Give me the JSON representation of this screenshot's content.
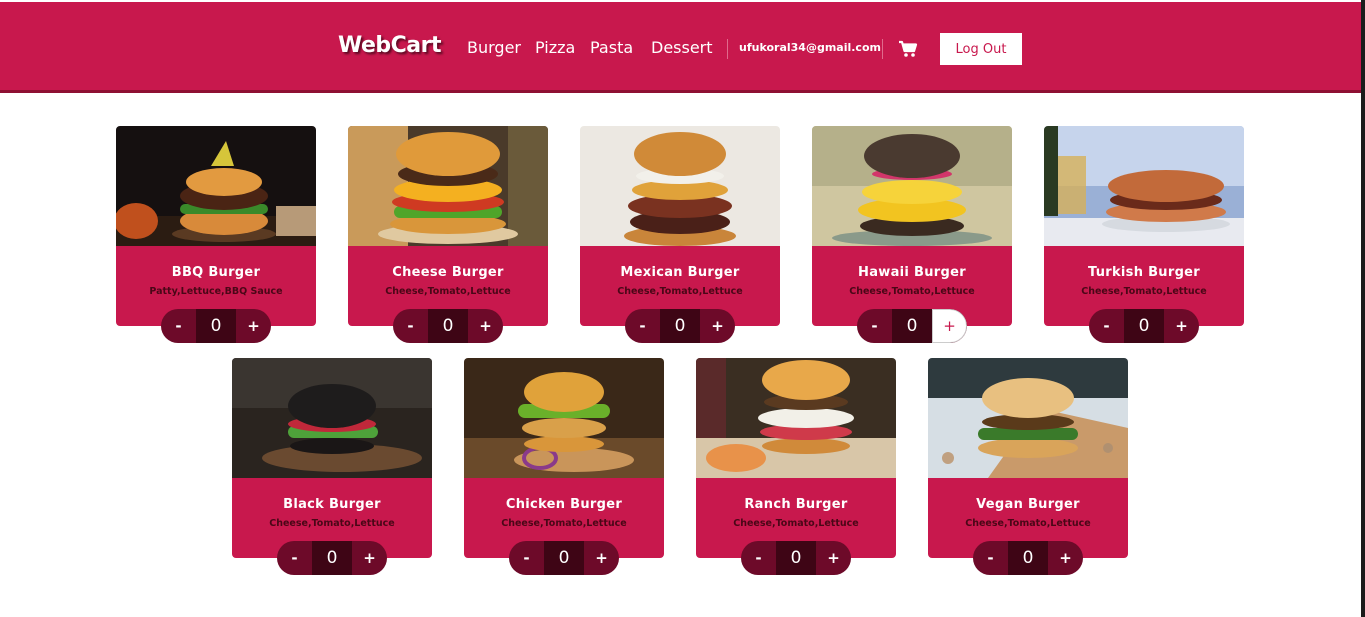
{
  "app": {
    "logo": "WebCart"
  },
  "nav": {
    "items": [
      "Burger",
      "Pizza",
      "Pasta",
      "Dessert"
    ]
  },
  "user": {
    "email": "ufukoral34@gmail.com"
  },
  "header": {
    "cart_icon": "shopping-cart-icon",
    "logout_label": "Log Out"
  },
  "colors": {
    "primary": "#c8184d",
    "stepper_dark": "#6d0a29",
    "count_bg": "#3e0515"
  },
  "products": [
    {
      "name": "BBQ Burger",
      "ingredients": "Patty,Lettuce,BBQ Sauce",
      "qty": "0",
      "minus": "-",
      "plus": "+"
    },
    {
      "name": "Cheese Burger",
      "ingredients": "Cheese,Tomato,Lettuce",
      "qty": "0",
      "minus": "-",
      "plus": "+"
    },
    {
      "name": "Mexican Burger",
      "ingredients": "Cheese,Tomato,Lettuce",
      "qty": "0",
      "minus": "-",
      "plus": "+"
    },
    {
      "name": "Hawaii Burger",
      "ingredients": "Cheese,Tomato,Lettuce",
      "qty": "0",
      "minus": "-",
      "plus": "+"
    },
    {
      "name": "Turkish Burger",
      "ingredients": "Cheese,Tomato,Lettuce",
      "qty": "0",
      "minus": "-",
      "plus": "+"
    },
    {
      "name": "Black Burger",
      "ingredients": "Cheese,Tomato,Lettuce",
      "qty": "0",
      "minus": "-",
      "plus": "+"
    },
    {
      "name": "Chicken Burger",
      "ingredients": "Cheese,Tomato,Lettuce",
      "qty": "0",
      "minus": "-",
      "plus": "+"
    },
    {
      "name": "Ranch Burger",
      "ingredients": "Cheese,Tomato,Lettuce",
      "qty": "0",
      "minus": "-",
      "plus": "+"
    },
    {
      "name": "Vegan Burger",
      "ingredients": "Cheese,Tomato,Lettuce",
      "qty": "0",
      "minus": "-",
      "plus": "+"
    }
  ]
}
